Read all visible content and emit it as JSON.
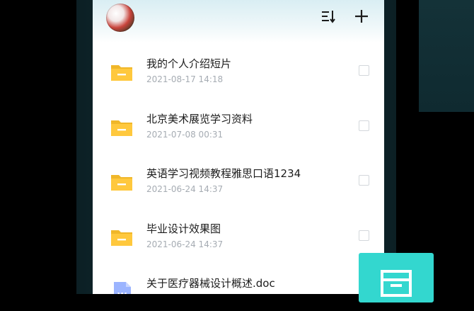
{
  "colors": {
    "accent_teal": "#33d7cf",
    "folder_yellow": "#ffc83d",
    "doc_blue": "#9bb4ff",
    "date_gray": "#a6acb3"
  },
  "header": {
    "avatar_icon": "user-avatar",
    "sort_icon": "sort-icon",
    "add_icon": "plus-icon"
  },
  "files": [
    {
      "name": "我的个人介绍短片",
      "date": "2021-08-17 14:18",
      "type": "folder"
    },
    {
      "name": "北京美术展览学习资料",
      "date": "2021-07-08 00:31",
      "type": "folder"
    },
    {
      "name": "英语学习视频教程雅思口语1234",
      "date": "2021-06-24 14:37",
      "type": "folder"
    },
    {
      "name": "毕业设计效果图",
      "date": "2021-06-24 14:37",
      "type": "folder"
    },
    {
      "name": "关于医疗器械设计概述.doc",
      "date": "",
      "type": "doc"
    }
  ],
  "fab": {
    "icon": "archive-box-icon"
  }
}
